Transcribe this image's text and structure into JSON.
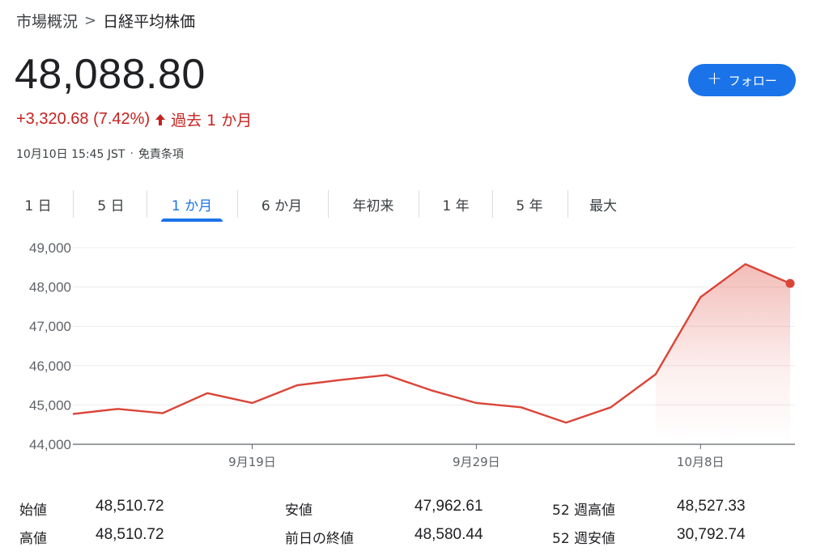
{
  "breadcrumb": {
    "parent": "市場概況",
    "separator": ">",
    "current": "日経平均株価"
  },
  "quote": {
    "price": "48,088.80",
    "change": "+3,320.68 (7.42%)",
    "period": "過去 1 か月",
    "timestamp": "10月10日 15:45 JST",
    "separator": "·",
    "disclaimer": "免責条項"
  },
  "follow_button": {
    "icon": "plus-icon",
    "label": "フォロー"
  },
  "tabs": [
    {
      "label": "1 日",
      "active": false
    },
    {
      "label": "5 日",
      "active": false
    },
    {
      "label": "1 か月",
      "active": true
    },
    {
      "label": "6 か月",
      "active": false
    },
    {
      "label": "年初来",
      "active": false
    },
    {
      "label": "1 年",
      "active": false
    },
    {
      "label": "5 年",
      "active": false
    },
    {
      "label": "最大",
      "active": false
    }
  ],
  "colors": {
    "accent": "#1a73e8",
    "negative_line": "#db4437",
    "change_text": "#c5221f",
    "grid": "#ececec",
    "axis_text": "#5f6368"
  },
  "chart_data": {
    "type": "area",
    "title": "",
    "xlabel": "",
    "ylabel": "",
    "ylim": [
      44000,
      49000
    ],
    "yticks": [
      44000,
      45000,
      46000,
      47000,
      48000,
      49000
    ],
    "ytick_labels": [
      "44,000",
      "45,000",
      "46,000",
      "47,000",
      "48,000",
      "49,000"
    ],
    "xtick_labels": [
      {
        "label": "9月19日",
        "index": 4
      },
      {
        "label": "9月29日",
        "index": 9
      },
      {
        "label": "10月8日",
        "index": 14
      }
    ],
    "grid": true,
    "series": [
      {
        "values": [
          44770,
          44900,
          44790,
          45300,
          45050,
          45500,
          45640,
          45760,
          45370,
          45050,
          44940,
          44550,
          44940,
          45780,
          47740,
          48580,
          48088.8
        ]
      }
    ]
  },
  "stats": [
    {
      "label": "始値",
      "value": "48,510.72"
    },
    {
      "label": "高値",
      "value": "48,510.72"
    },
    {
      "label": "安値",
      "value": "47,962.61"
    },
    {
      "label": "前日の終値",
      "value": "48,580.44"
    },
    {
      "label": "52 週高値",
      "value": "48,527.33"
    },
    {
      "label": "52 週安値",
      "value": "30,792.74"
    }
  ]
}
